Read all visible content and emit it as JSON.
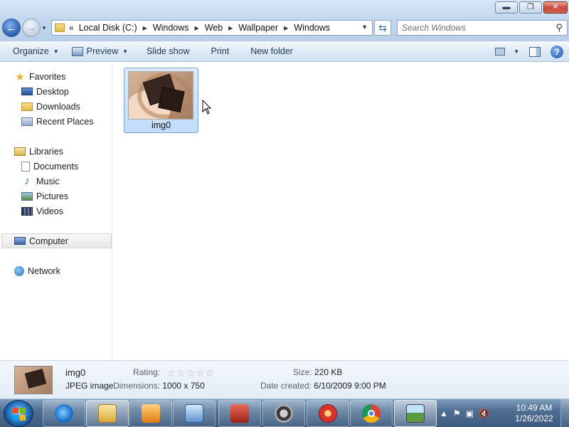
{
  "window": {
    "buttons": {
      "minimize": "▬",
      "maximize": "❐",
      "close": "✕"
    }
  },
  "address": {
    "lead": "«",
    "crumbs": [
      "Local Disk (C:)",
      "Windows",
      "Web",
      "Wallpaper",
      "Windows"
    ]
  },
  "search": {
    "placeholder": "Search Windows"
  },
  "toolbar": {
    "organize": "Organize",
    "preview": "Preview",
    "slideshow": "Slide show",
    "print": "Print",
    "new_folder": "New folder",
    "help": "?"
  },
  "nav": {
    "favorites": "Favorites",
    "desktop": "Desktop",
    "downloads": "Downloads",
    "recent": "Recent Places",
    "libraries": "Libraries",
    "documents": "Documents",
    "music": "Music",
    "pictures": "Pictures",
    "videos": "Videos",
    "computer": "Computer",
    "network": "Network"
  },
  "files": [
    {
      "name": "img0"
    }
  ],
  "details": {
    "name": "img0",
    "type": "JPEG image",
    "rating_label": "Rating:",
    "rating": 0,
    "rating_max": 5,
    "dimensions_label": "Dimensions:",
    "dimensions": "1000 x 750",
    "size_label": "Size:",
    "size": "220 KB",
    "date_label": "Date created:",
    "date": "6/10/2009 9:00 PM"
  },
  "taskbar": {
    "time": "10:49 AM",
    "date": "1/26/2022",
    "apps": [
      "internet-explorer-icon",
      "windows-explorer-icon",
      "media-player-icon",
      "control-panel-icon",
      "toolbox-icon",
      "raccoon-app-icon",
      "burner-app-icon",
      "chrome-icon",
      "photo-viewer-icon"
    ]
  },
  "colors": {
    "accent": "#3a6fc0",
    "selection": "#c1dcfc",
    "taskbar": "#4f6f93"
  }
}
